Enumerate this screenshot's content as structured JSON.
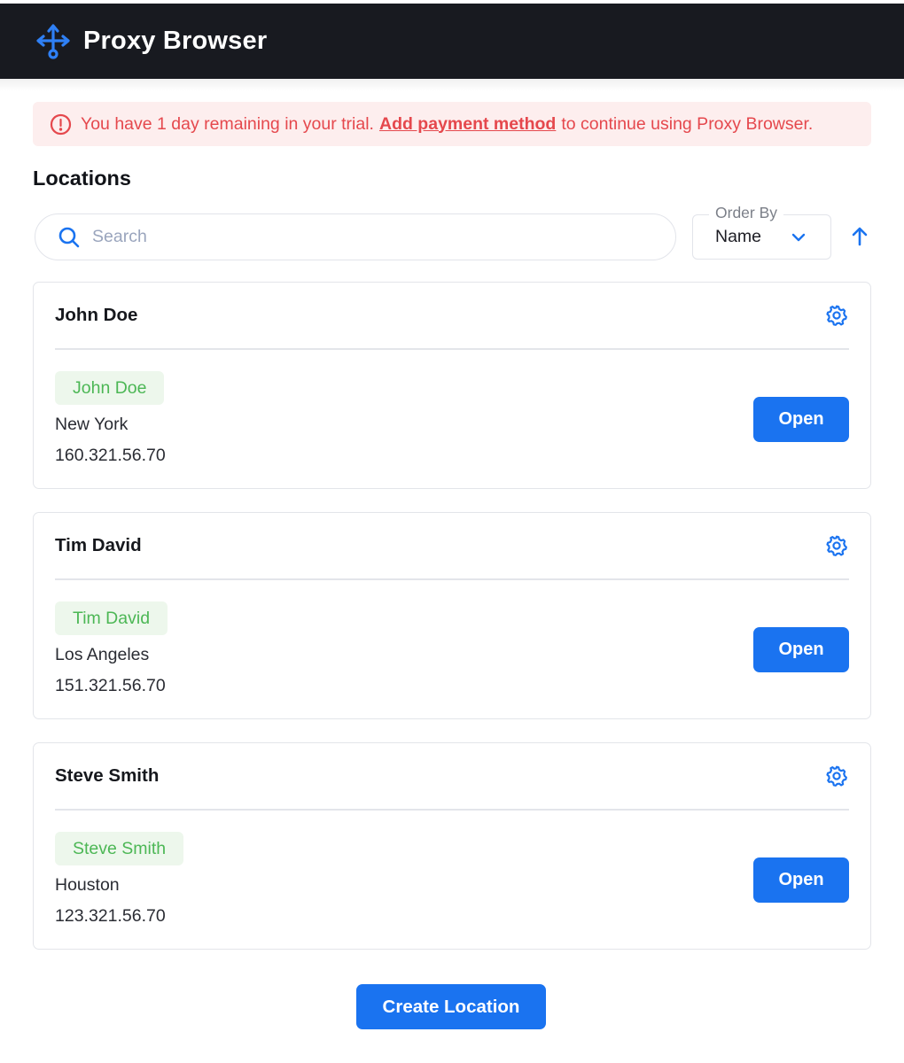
{
  "app": {
    "title": "Proxy Browser",
    "logo_icon": "arrows-split-icon"
  },
  "alert": {
    "before": "You have 1 day remaining in your trial.",
    "link": "Add payment method",
    "after": "to continue using Proxy Browser.",
    "color": "#e5484d"
  },
  "locations": {
    "heading": "Locations",
    "search_placeholder": "Search",
    "order_by_label": "Order By",
    "order_by_value": "Name",
    "sort_direction": "ascending",
    "items": [
      {
        "title": "John Doe",
        "tag": "John Doe",
        "city": "New York",
        "ip": "160.321.56.70",
        "open_label": "Open"
      },
      {
        "title": "Tim David",
        "tag": "Tim David",
        "city": "Los Angeles",
        "ip": "151.321.56.70",
        "open_label": "Open"
      },
      {
        "title": "Steve Smith",
        "tag": "Steve Smith",
        "city": "Houston",
        "ip": "123.321.56.70",
        "open_label": "Open"
      }
    ]
  },
  "create_label": "Create Location",
  "colors": {
    "accent": "#1a73f0",
    "header_bg": "#181a20",
    "tag_text": "#4cb755",
    "tag_bg": "#edf7ec"
  }
}
